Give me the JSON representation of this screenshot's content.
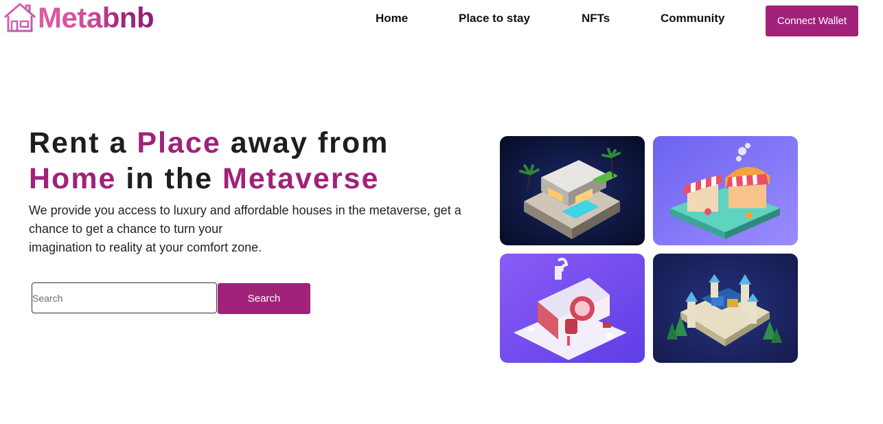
{
  "header": {
    "logo_text": "Metabnb",
    "logo_icon": "house-icon",
    "nav": [
      {
        "label": "Home"
      },
      {
        "label": "Place to stay"
      },
      {
        "label": "NFTs"
      },
      {
        "label": "Community"
      }
    ],
    "connect_button": "Connect Wallet"
  },
  "hero": {
    "title_parts": [
      "Rent a ",
      "Place",
      " away from",
      "Home",
      " in the ",
      "Metaverse"
    ],
    "description_lines": [
      "We provide you access to luxury and affordable houses in the metaverse, get a",
      "chance to get a chance to turn your",
      "imagination to reality at your comfort zone."
    ],
    "search": {
      "placeholder": "Search",
      "value": "",
      "button_label": "Search"
    }
  },
  "gallery": [
    {
      "name": "modern-villa-tile",
      "scene": "modern house with pool at night"
    },
    {
      "name": "market-stalls-tile",
      "scene": "striped market stalls on purple"
    },
    {
      "name": "snow-house-tile",
      "scene": "snowy gingerbread cottage"
    },
    {
      "name": "castle-tile",
      "scene": "stone castle with blue turrets"
    }
  ],
  "colors": {
    "accent": "#a02279",
    "logo_gradient_start": "#e05ba2",
    "logo_gradient_end": "#8b1f74",
    "text": "#1e1e1e"
  }
}
